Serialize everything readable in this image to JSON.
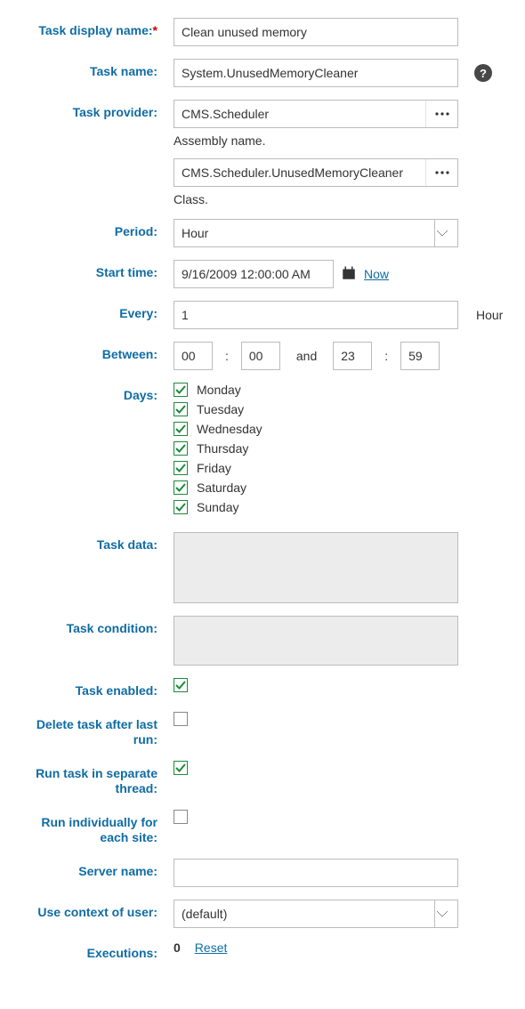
{
  "labels": {
    "task_display_name": "Task display name:",
    "task_name": "Task name:",
    "task_provider": "Task provider:",
    "assembly_name_helper": "Assembly name.",
    "class_helper": "Class.",
    "period": "Period:",
    "start_time": "Start time:",
    "every": "Every:",
    "between": "Between:",
    "days": "Days:",
    "task_data": "Task data:",
    "task_condition": "Task condition:",
    "task_enabled": "Task enabled:",
    "delete_after_last_run": "Delete task after last run:",
    "run_separate_thread": "Run task in separate thread:",
    "run_individually": "Run individually for each site:",
    "server_name": "Server name:",
    "use_context_of_user": "Use context of user:",
    "executions": "Executions:",
    "now": "Now",
    "reset": "Reset",
    "and": "and",
    "required_mark": "*"
  },
  "values": {
    "task_display_name": "Clean unused memory",
    "task_name": "System.UnusedMemoryCleaner",
    "assembly": "CMS.Scheduler",
    "class": "CMS.Scheduler.UnusedMemoryCleaner",
    "period": "Hour",
    "start_time": "9/16/2009 12:00:00 AM",
    "every": "1",
    "every_unit": "Hour",
    "between_from_h": "00",
    "between_from_m": "00",
    "between_to_h": "23",
    "between_to_m": "59",
    "task_data": "",
    "task_condition": "",
    "task_enabled": true,
    "delete_after_last_run": false,
    "run_separate_thread": true,
    "run_individually": false,
    "server_name": "",
    "use_context_of_user": "(default)",
    "executions": "0"
  },
  "days": [
    {
      "label": "Monday",
      "checked": true
    },
    {
      "label": "Tuesday",
      "checked": true
    },
    {
      "label": "Wednesday",
      "checked": true
    },
    {
      "label": "Thursday",
      "checked": true
    },
    {
      "label": "Friday",
      "checked": true
    },
    {
      "label": "Saturday",
      "checked": true
    },
    {
      "label": "Sunday",
      "checked": true
    }
  ]
}
